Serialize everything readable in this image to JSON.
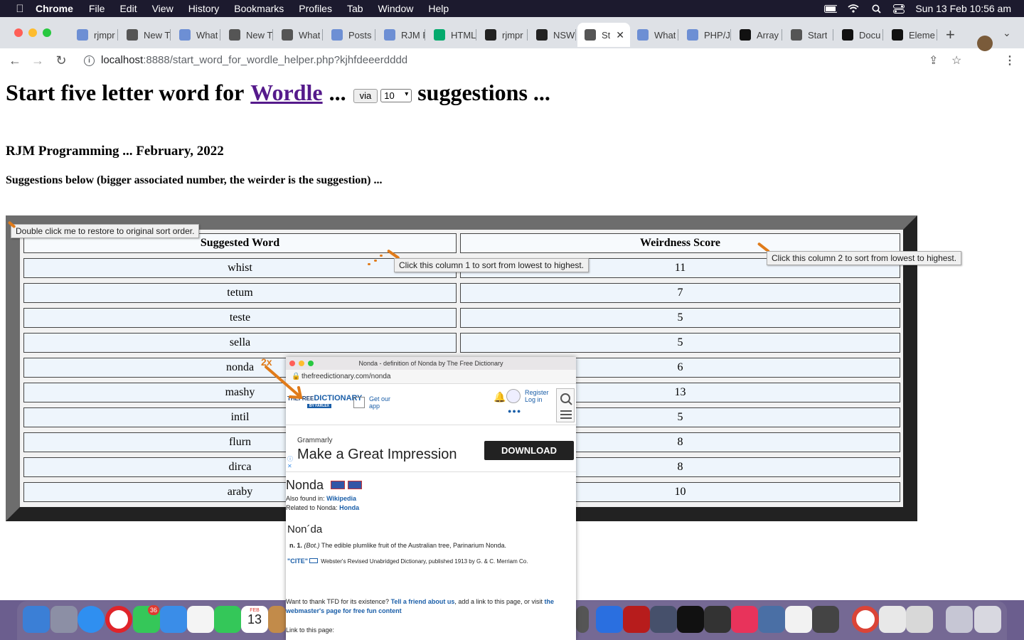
{
  "menubar": {
    "app": "Chrome",
    "items": [
      "File",
      "Edit",
      "View",
      "History",
      "Bookmarks",
      "Profiles",
      "Tab",
      "Window",
      "Help"
    ],
    "datetime": "Sun 13 Feb  10:56 am"
  },
  "tabs": [
    {
      "label": "rjmpr",
      "color": "#6d8fd4"
    },
    {
      "label": "New T",
      "color": "#555555"
    },
    {
      "label": "What",
      "color": "#6d8fd4"
    },
    {
      "label": "New T",
      "color": "#555555"
    },
    {
      "label": "What",
      "color": "#555555"
    },
    {
      "label": "Posts",
      "color": "#6d8fd4"
    },
    {
      "label": "RJM F",
      "color": "#6d8fd4"
    },
    {
      "label": "HTML",
      "color": "#04aa6d"
    },
    {
      "label": "rjmpr",
      "color": "#222222"
    },
    {
      "label": "NSW",
      "color": "#222222"
    },
    {
      "label": "St",
      "color": "#555555",
      "active": true
    },
    {
      "label": "What",
      "color": "#6d8fd4"
    },
    {
      "label": "PHP/J",
      "color": "#6d8fd4"
    },
    {
      "label": "Array",
      "color": "#111111"
    },
    {
      "label": "Start",
      "color": "#555555"
    },
    {
      "label": "Docu",
      "color": "#111111"
    },
    {
      "label": "Eleme",
      "color": "#111111"
    }
  ],
  "address": {
    "host": "localhost",
    "rest": ":8888/start_word_for_wordle_helper.php?kjhfdeeerdddd"
  },
  "page": {
    "title_prefix": "Start five letter word for",
    "title_link": "Wordle",
    "title_dots": "...",
    "via_button": "via",
    "count_select": "10",
    "title_suffix": "suggestions ...",
    "byline": "RJM Programming ... February, 2022",
    "explain": "Suggestions below (bigger associated number, the weirder is the suggestion) ..."
  },
  "table": {
    "headers": [
      "Suggested Word",
      "Weirdness Score"
    ],
    "rows": [
      {
        "word": "whist",
        "score": "11"
      },
      {
        "word": "tetum",
        "score": "7"
      },
      {
        "word": "teste",
        "score": "5"
      },
      {
        "word": "sella",
        "score": "5"
      },
      {
        "word": "nonda",
        "score": "6"
      },
      {
        "word": "mashy",
        "score": "13"
      },
      {
        "word": "intil",
        "score": "5"
      },
      {
        "word": "flurn",
        "score": "8"
      },
      {
        "word": "dirca",
        "score": "8"
      },
      {
        "word": "araby",
        "score": "10"
      }
    ]
  },
  "tooltips": {
    "restore": "Double click me to restore to original sort order.",
    "col1": "Click this column 1 to sort from lowest to highest.",
    "col2": "Click this column 2 to sort from lowest to highest."
  },
  "annotation": {
    "label": "2x",
    "color": "#e07b1a"
  },
  "popup": {
    "window_title": "Nonda - definition of Nonda by The Free Dictionary",
    "url": "thefreedictionary.com/nonda",
    "logo_the": "THE",
    "logo_free": "FREE",
    "logo_dictionary": "DICTIONARY",
    "logo_by": "BY FARLEX",
    "get_app": "Get our app",
    "register": "Register",
    "login": "Log in",
    "ad_brand": "Grammarly",
    "ad_headline": "Make a Great Impression",
    "ad_button": "DOWNLOAD",
    "word": "Nonda",
    "also_found_label": "Also found in:",
    "also_found_link": "Wikipedia",
    "related_label": "Related to Nonda:",
    "related_link": "Honda",
    "pron": "Non´da",
    "def_num": "n. 1.",
    "def_field": "(Bot.)",
    "def_text": "The edible plumlike fruit of the Australian tree, Parinarium Nonda.",
    "cite": "\"CITE\"",
    "source": "Webster's Revised Unabridged Dictionary, published 1913 by G. & C. Merriam Co.",
    "thank_text_1": "Want to thank TFD for its existence?",
    "thank_link_1": "Tell a friend about us",
    "thank_text_2": ", add a link to this page, or visit",
    "thank_link_2": "the webmaster's page for free fun content",
    "link_label": "Link to this page:"
  },
  "dock": {
    "badge": "36",
    "calendar_month": "FEB",
    "calendar_day": "13"
  }
}
